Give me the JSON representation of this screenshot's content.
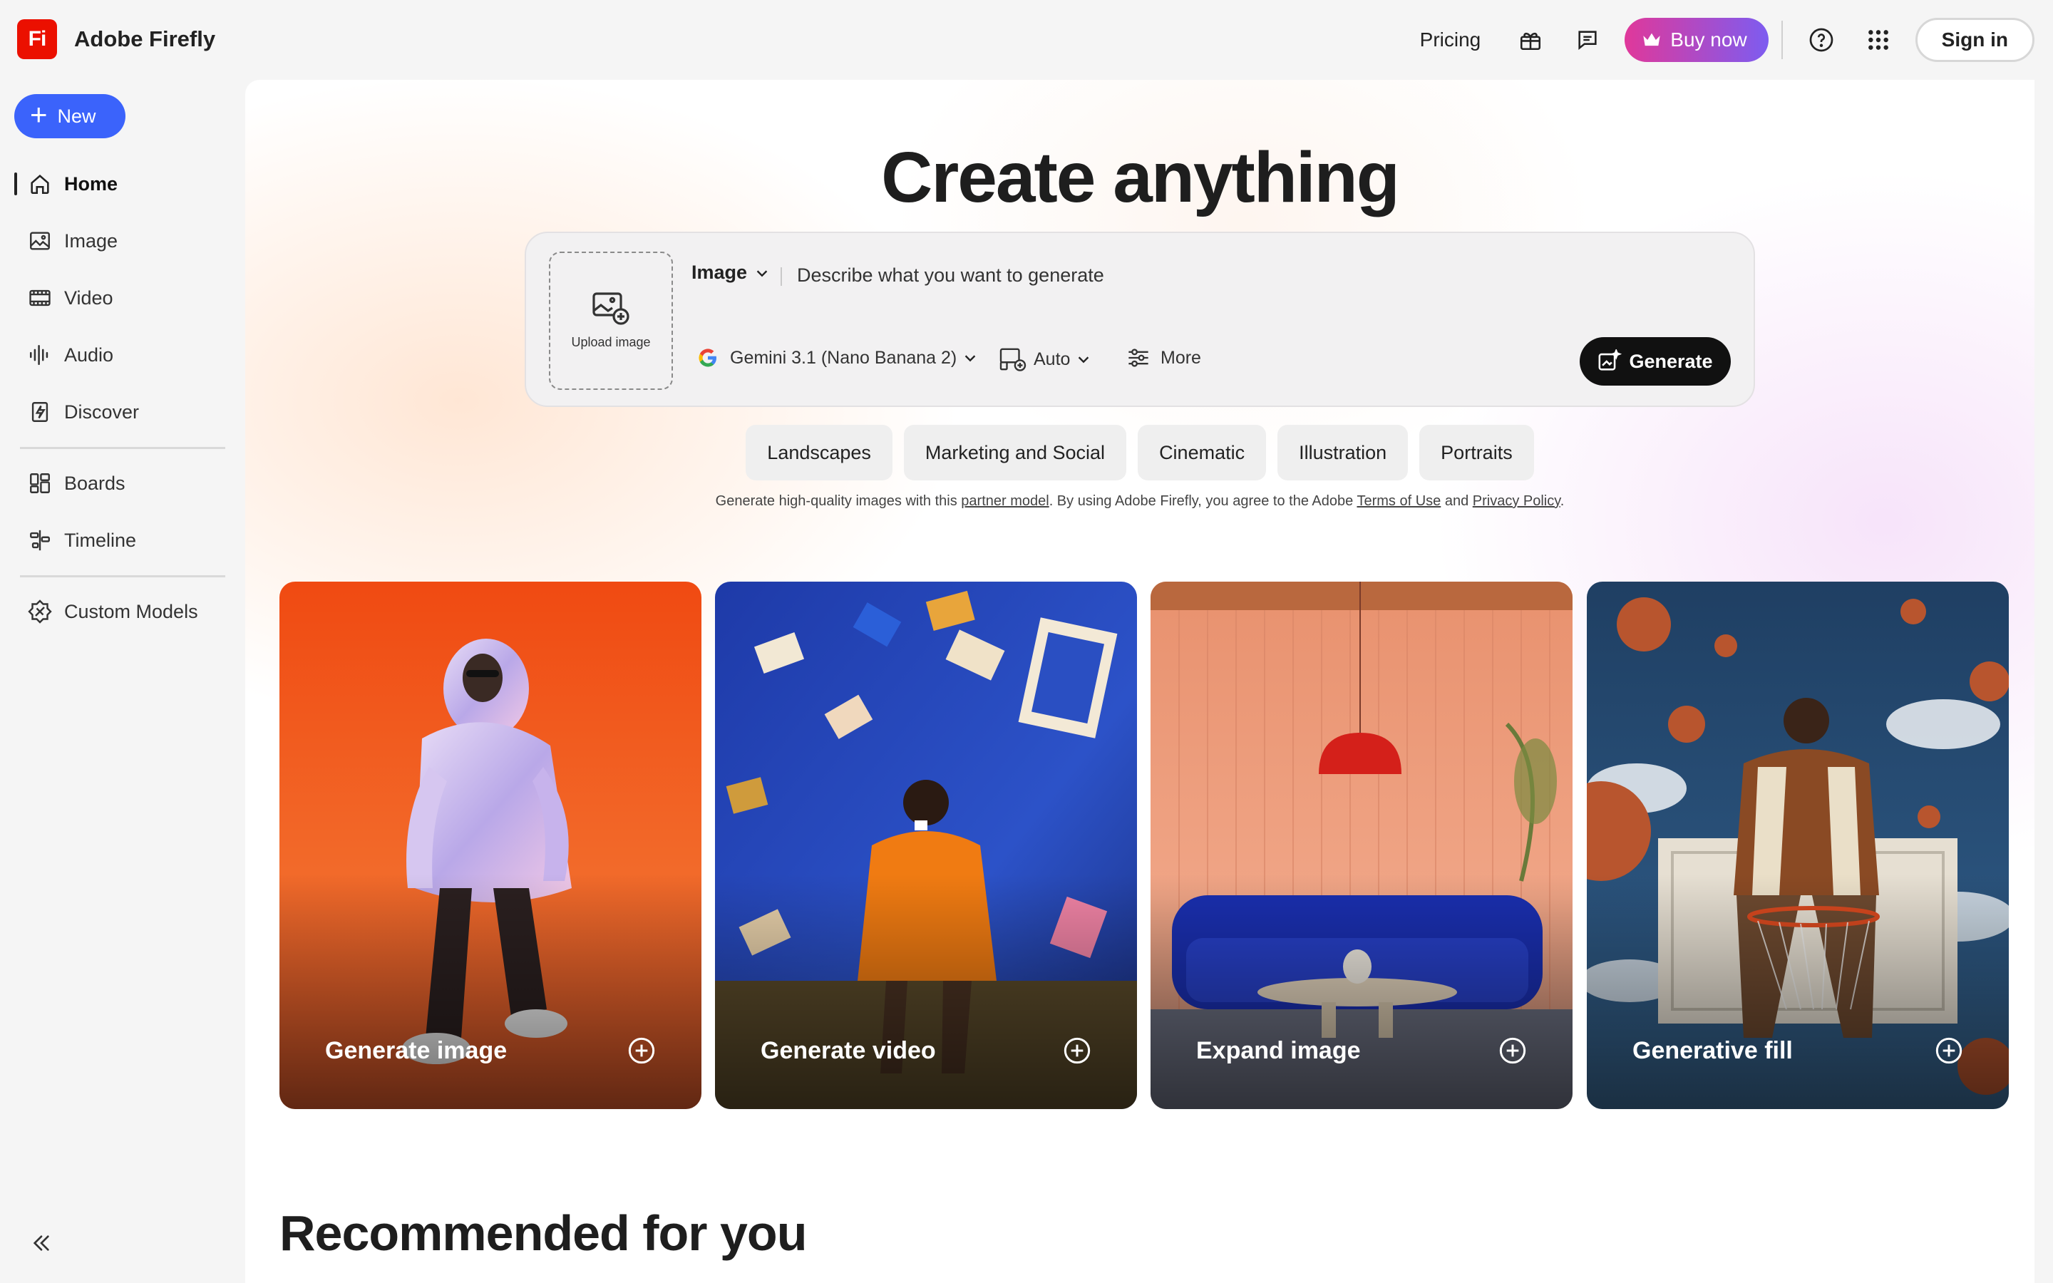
{
  "header": {
    "brand_logo": "Fi",
    "brand_name": "Adobe Firefly",
    "pricing_label": "Pricing",
    "buy_label": "Buy now",
    "signin_label": "Sign in",
    "icons": [
      "gift-icon",
      "chat-icon",
      "crown-icon",
      "help-icon",
      "app-grid-icon"
    ]
  },
  "sidebar": {
    "new_label": "New",
    "items": [
      {
        "label": "Home",
        "icon": "home-icon",
        "active": true
      },
      {
        "label": "Image",
        "icon": "image-icon"
      },
      {
        "label": "Video",
        "icon": "video-icon"
      },
      {
        "label": "Audio",
        "icon": "audio-icon"
      },
      {
        "label": "Discover",
        "icon": "discover-icon"
      },
      {
        "label": "Boards",
        "icon": "boards-icon"
      },
      {
        "label": "Timeline",
        "icon": "timeline-icon"
      },
      {
        "label": "Custom Models",
        "icon": "custom-models-icon"
      }
    ],
    "collapse_icon": "collapse-icon"
  },
  "hero": {
    "title": "Create anything"
  },
  "prompt": {
    "upload_label": "Upload image",
    "mode_label": "Image",
    "placeholder": "Describe what you want to generate",
    "model_label": "Gemini 3.1 (Nano Banana 2)",
    "ratio_label": "Auto",
    "more_label": "More",
    "generate_label": "Generate"
  },
  "chips": [
    "Landscapes",
    "Marketing and Social",
    "Cinematic",
    "Illustration",
    "Portraits"
  ],
  "disclaimer": {
    "part1": "Generate high-quality images with this ",
    "link1": "partner model",
    "part2": ".  By using Adobe Firefly, you agree to the Adobe ",
    "link2": "Terms of Use",
    "part3": " and ",
    "link3": "Privacy Policy",
    "part4": "."
  },
  "cards": [
    {
      "title": "Generate image"
    },
    {
      "title": "Generate video"
    },
    {
      "title": "Expand image"
    },
    {
      "title": "Generative fill"
    }
  ],
  "recommended": {
    "title": "Recommended for you"
  },
  "colors": {
    "accent_blue": "#3b63fb",
    "brand_red": "#eb1000",
    "buy_gradient_start": "#e0389a",
    "buy_gradient_end": "#7d5cf0"
  }
}
